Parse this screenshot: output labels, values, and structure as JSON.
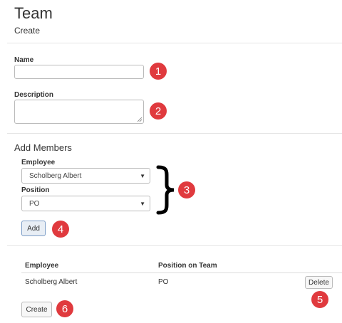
{
  "header": {
    "title": "Team",
    "subtitle": "Create"
  },
  "form": {
    "name_label": "Name",
    "name_value": "",
    "description_label": "Description",
    "description_value": ""
  },
  "add_members": {
    "heading": "Add Members",
    "employee_label": "Employee",
    "employee_selected": "Scholberg Albert",
    "position_label": "Position",
    "position_selected": "PO",
    "add_label": "Add"
  },
  "table": {
    "headers": [
      "Employee",
      "Position on Team"
    ],
    "rows": [
      {
        "employee": "Scholberg Albert",
        "position": "PO",
        "delete_label": "Delete"
      }
    ]
  },
  "create_label": "Create",
  "callouts": [
    "1",
    "2",
    "3",
    "4",
    "5",
    "6"
  ],
  "colors": {
    "callout": "#e03a3e"
  }
}
